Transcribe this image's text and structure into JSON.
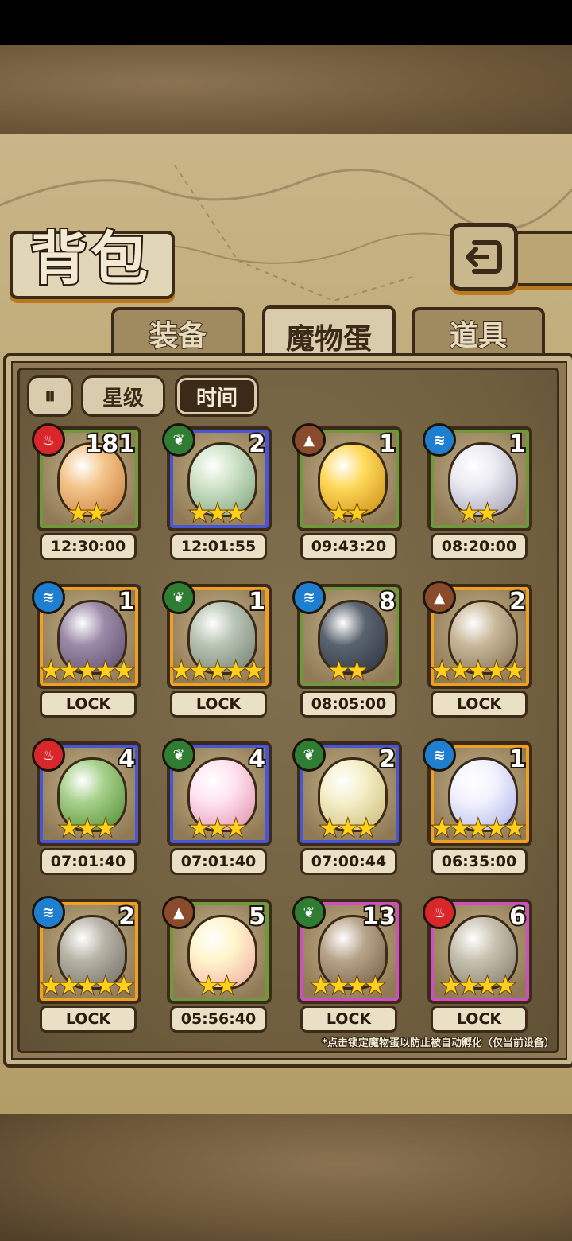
{
  "title": "背包",
  "tabs": [
    {
      "label": "装备",
      "active": false
    },
    {
      "label": "魔物蛋",
      "active": true
    },
    {
      "label": "道具",
      "active": false
    }
  ],
  "filters": {
    "toggle_icon": "pause-sort-icon",
    "star_label": "星级",
    "time_label": "时间",
    "active": "时间"
  },
  "items": [
    {
      "element": "fire",
      "count": "181",
      "stars": "★★",
      "timer": "12:30:00",
      "rarity_color": "#6d9a3a"
    },
    {
      "element": "leaf",
      "count": "2",
      "stars": "★★★",
      "timer": "12:01:55",
      "rarity_color": "#4656d6"
    },
    {
      "element": "earth",
      "count": "1",
      "stars": "★★",
      "timer": "09:43:20",
      "rarity_color": "#6d9a3a"
    },
    {
      "element": "water",
      "count": "1",
      "stars": "★★",
      "timer": "08:20:00",
      "rarity_color": "#6d9a3a"
    },
    {
      "element": "water",
      "count": "1",
      "stars": "★★★★★",
      "timer": "LOCK",
      "rarity_color": "#f0a020"
    },
    {
      "element": "leaf",
      "count": "1",
      "stars": "★★★★★",
      "timer": "LOCK",
      "rarity_color": "#f0a020"
    },
    {
      "element": "water",
      "count": "8",
      "stars": "★★",
      "timer": "08:05:00",
      "rarity_color": "#6d9a3a"
    },
    {
      "element": "earth",
      "count": "2",
      "stars": "★★★★★",
      "timer": "LOCK",
      "rarity_color": "#f0a020"
    },
    {
      "element": "fire",
      "count": "4",
      "stars": "★★★",
      "timer": "07:01:40",
      "rarity_color": "#4656d6"
    },
    {
      "element": "leaf",
      "count": "4",
      "stars": "★★★",
      "timer": "07:01:40",
      "rarity_color": "#4656d6"
    },
    {
      "element": "leaf",
      "count": "2",
      "stars": "★★★",
      "timer": "07:00:44",
      "rarity_color": "#4656d6"
    },
    {
      "element": "water",
      "count": "1",
      "stars": "★★★★★",
      "timer": "06:35:00",
      "rarity_color": "#f0a020"
    },
    {
      "element": "water",
      "count": "2",
      "stars": "★★★★★",
      "timer": "LOCK",
      "rarity_color": "#f0a020"
    },
    {
      "element": "earth",
      "count": "5",
      "stars": "★★",
      "timer": "05:56:40",
      "rarity_color": "#6d9a3a"
    },
    {
      "element": "leaf",
      "count": "13",
      "stars": "★★★★",
      "timer": "LOCK",
      "rarity_color": "#d04fc0"
    },
    {
      "element": "fire",
      "count": "6",
      "stars": "★★★★",
      "timer": "LOCK",
      "rarity_color": "#d04fc0"
    }
  ],
  "hint": "*点击锁定魔物蛋以防止被自动孵化（仅当前设备）"
}
